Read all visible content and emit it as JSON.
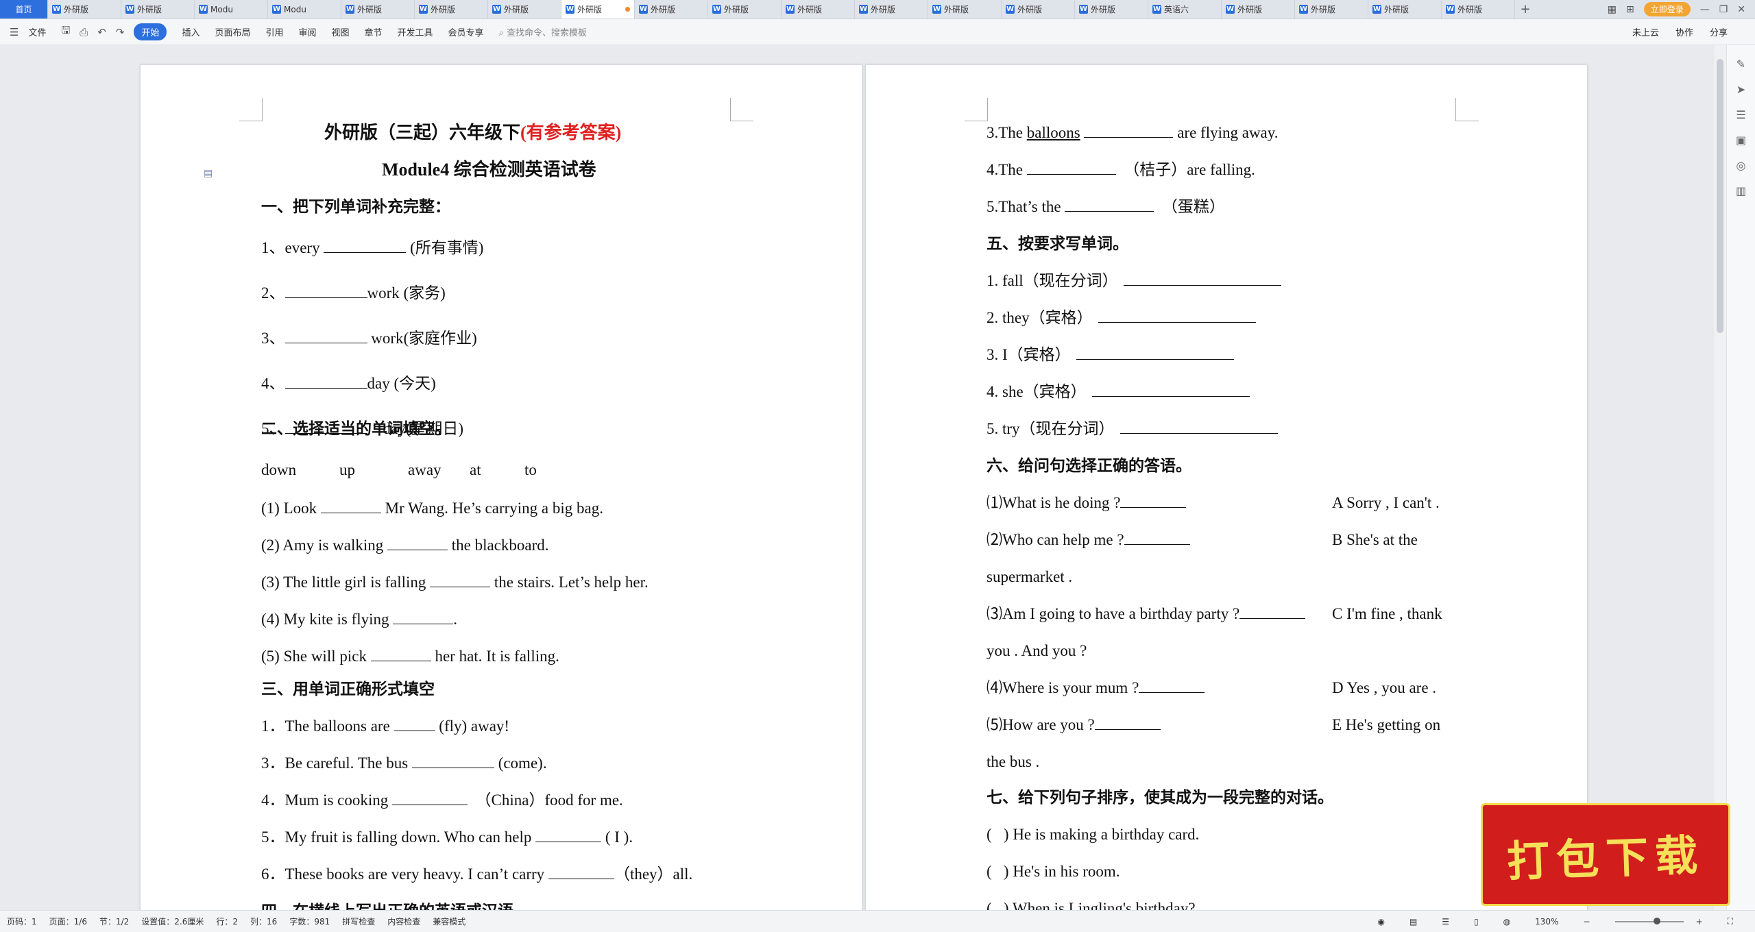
{
  "tabs": {
    "home": "首页",
    "items": [
      "外研版",
      "外研版",
      "Modu",
      "Modu",
      "外研版",
      "外研版",
      "外研版",
      "外研版",
      "外研版",
      "外研版",
      "外研版",
      "外研版",
      "外研版",
      "外研版",
      "外研版",
      "英语六",
      "外研版",
      "外研版",
      "外研版",
      "外研版"
    ],
    "active_index": 7
  },
  "titlebar": {
    "login": "立即登录"
  },
  "toolbar": {
    "file": "文件",
    "start": "开始",
    "insert": "插入",
    "layout": "页面布局",
    "ref": "引用",
    "review": "审阅",
    "view": "视图",
    "section": "章节",
    "dev": "开发工具",
    "member": "会员专享",
    "search": "查找命令、搜索模板",
    "cloud": "未上云",
    "collab": "协作",
    "share": "分享"
  },
  "page1": {
    "title_black": "外研版（三起）六年级下",
    "title_red": "(有参考答案)",
    "subtitle": "Module4 综合检测英语试卷",
    "s1": "一、把下列单词补充完整：",
    "s1_items": [
      {
        "pre": "1、every ",
        "post": " (所有事情)"
      },
      {
        "pre": "2、",
        "post": "work (家务)"
      },
      {
        "pre": "3、",
        "post": " work(家庭作业)"
      },
      {
        "pre": "4、",
        "post": "day (今天)"
      },
      {
        "pre": "5、",
        "post": "    day(星期日)"
      }
    ],
    "s2": "二、选择适当的单词填空。",
    "words": [
      "down",
      "up",
      "away",
      "at",
      "to"
    ],
    "s2_items": [
      {
        "pre": "(1) Look ",
        "post": " Mr Wang. He’s carrying a big bag."
      },
      {
        "pre": "(2) Amy is walking ",
        "post": " the blackboard."
      },
      {
        "pre": "(3) The little girl is falling ",
        "post": " the stairs. Let’s help her."
      },
      {
        "pre": "(4) My kite is flying ",
        "post": "."
      },
      {
        "pre": "(5) She will pick ",
        "post": " her hat. It is falling."
      }
    ],
    "s3": "三、用单词正确形式填空",
    "s3_items": [
      {
        "pre": "1．The balloons are ",
        "post": " (fly) away!"
      },
      {
        "pre": "3．Be careful. The bus ",
        "post": " (come)."
      },
      {
        "pre": "4．Mum is cooking ",
        "post": "  （China）food for me."
      },
      {
        "pre": "5．My fruit is falling down. Who can help ",
        "post": " ( I )."
      },
      {
        "pre": "6．These books are very heavy. I can’t carry ",
        "post": "（they）all."
      }
    ],
    "s4_partial": "四、在横线上写出正确的英语或汉语"
  },
  "page2": {
    "lines_top": [
      {
        "pre": "3.The ",
        "u": "balloons",
        "post": " are flying away."
      },
      {
        "pre": "4.The ",
        "u": "",
        "post": "  （桔子）are falling."
      },
      {
        "pre": "5.That’s the ",
        "u": "",
        "post": "  （蛋糕）"
      }
    ],
    "s5": "五、按要求写单词。",
    "s5_items": [
      "1. fall（现在分词）",
      "2. they（宾格）",
      "3. I（宾格）",
      "4. she（宾格）",
      "5. try（现在分词）"
    ],
    "s6": "六、给问句选择正确的答语。",
    "s6_q": [
      {
        "q": "⑴What is he doing ?",
        "a": "A Sorry , I can't ."
      },
      {
        "q": "⑵Who can help me ?",
        "a": "B She's at the"
      },
      {
        "q": "",
        "a": "supermarket ."
      },
      {
        "q": "⑶Am I going to have a birthday party ?",
        "a": "C I'm fine , thank"
      },
      {
        "q": "",
        "a": "you . And you ?"
      },
      {
        "q": "⑷Where is your mum ?",
        "a": "D Yes , you are ."
      },
      {
        "q": "⑸How are you ?",
        "a": "E He's getting on"
      },
      {
        "q": "",
        "a": "the bus ."
      }
    ],
    "s7": "七、给下列句子排序，使其成为一段完整的对话。",
    "s7_items": [
      "(   ) He is making a birthday card.",
      "(   ) He's in his room."
    ],
    "s7_partial": "(   ) When is Lingling's birthday?"
  },
  "statusbar": {
    "page_no": "页码：1",
    "pages": "页面：1/6",
    "section": "节：1/2",
    "setting": "设置值：2.6厘米",
    "row": "行：2",
    "col": "列：16",
    "words": "字数：981",
    "spell": "拼写检查",
    "content": "内容检查",
    "compat": "兼容模式",
    "zoom": "130%"
  },
  "badge": "打包下载"
}
